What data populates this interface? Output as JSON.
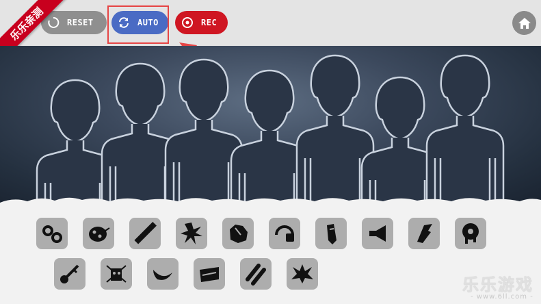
{
  "ribbon": {
    "text": "乐乐亲测"
  },
  "controls": {
    "reset_label": "RESET",
    "auto_label": "AUTO",
    "rec_label": "REC"
  },
  "icons": {
    "home": "home-icon",
    "reset": "refresh-icon",
    "auto": "sync-arrows-icon",
    "rec": "record-icon"
  },
  "colors": {
    "reset_button": "#8f8f8f",
    "auto_button": "#4a6bc4",
    "rec_button": "#cf1622",
    "highlight": "#e64545",
    "pad": "#adadad"
  },
  "stage": {
    "characters": 7
  },
  "sound_pads": {
    "row1": [
      "goggles-icon",
      "ladybug-icon",
      "baton-icon",
      "splash-icon",
      "rock-icon",
      "headphone-icon",
      "pen-icon",
      "horn-icon",
      "glitch-icon",
      "eye-drip-icon"
    ],
    "row2": [
      "key-icon",
      "robot-icon",
      "leaf-icon",
      "tape-icon",
      "double-stripe-icon",
      "spiky-icon"
    ]
  },
  "watermark": {
    "text": "乐乐游戏",
    "url": "- www.6ll.com -"
  }
}
